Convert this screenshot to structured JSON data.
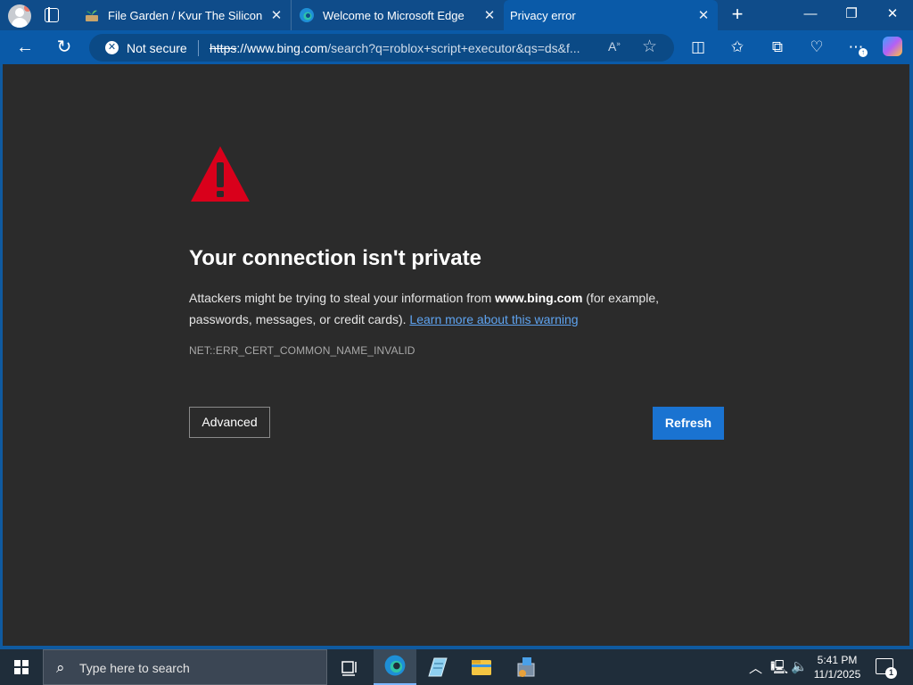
{
  "tabs": [
    {
      "title": "File Garden / Kvur The Silicon",
      "close": "✕"
    },
    {
      "title": "Welcome to Microsoft Edge",
      "close": "✕"
    },
    {
      "title": "Privacy error",
      "close": "✕"
    }
  ],
  "window_controls": {
    "minimize": "—",
    "maximize": "❐",
    "close": "✕"
  },
  "address_bar": {
    "security_label": "Not secure",
    "url_scheme": "https",
    "url_host": "://www.bing.com",
    "url_rest": "/search?q=roblox+script+executor&qs=ds&f..."
  },
  "error_page": {
    "heading": "Your connection isn't private",
    "message_before": "Attackers might be trying to steal your information from ",
    "message_host": "www.bing.com",
    "message_after": " (for example, passwords, messages, or credit cards). ",
    "learn_more": "Learn more about this warning",
    "error_code": "NET::ERR_CERT_COMMON_NAME_INVALID",
    "advanced_button": "Advanced",
    "refresh_button": "Refresh"
  },
  "taskbar": {
    "search_placeholder": "Type here to search",
    "time": "5:41 PM",
    "date": "11/1/2025",
    "notification_count": "1"
  },
  "colors": {
    "accent": "#0a5aa8",
    "warning_red": "#d9001b",
    "link": "#5ea3f0",
    "button_primary": "#1a73d1"
  }
}
